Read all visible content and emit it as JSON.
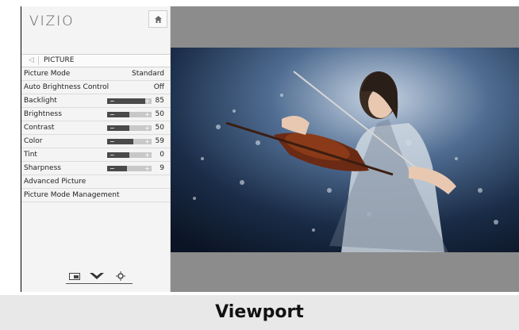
{
  "brand": {
    "logo": "VIZIO"
  },
  "menu": {
    "back_icon": "chevron-left-icon",
    "title": "PICTURE",
    "rows": [
      {
        "label": "Picture Mode",
        "value": "Standard"
      },
      {
        "label": "Auto Brightness Control",
        "value": "Off"
      },
      {
        "label": "Backlight",
        "value": "85",
        "level": 0.85
      },
      {
        "label": "Brightness",
        "value": "50",
        "level": 0.5
      },
      {
        "label": "Contrast",
        "value": "50",
        "level": 0.5
      },
      {
        "label": "Color",
        "value": "59",
        "level": 0.59
      },
      {
        "label": "Tint",
        "value": "0",
        "level": 0.5
      },
      {
        "label": "Sharpness",
        "value": "9",
        "level": 0.45
      },
      {
        "label": "Advanced Picture"
      },
      {
        "label": "Picture Mode Management"
      }
    ]
  },
  "footer_icons": [
    "input-icon",
    "chevron-down-icon",
    "settings-icon"
  ],
  "caption": "Viewport",
  "colors": {
    "panel": "#f4f4f4",
    "slider_fill": "#4a4a4a",
    "slider_track": "#c8c8c8",
    "tv_background": "#8c8c8c"
  }
}
